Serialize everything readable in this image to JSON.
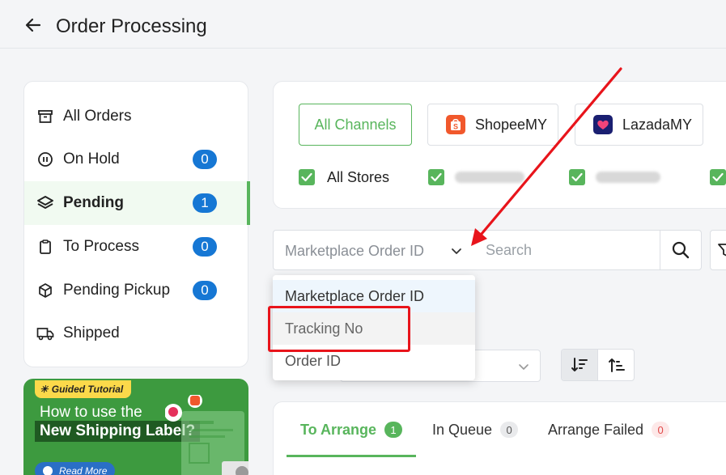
{
  "header": {
    "title": "Order Processing"
  },
  "sidebar": {
    "items": [
      {
        "label": "All Orders",
        "icon": "archive-box-icon",
        "count": null,
        "active": false
      },
      {
        "label": "On Hold",
        "icon": "pause-circle-icon",
        "count": "0",
        "active": false
      },
      {
        "label": "Pending",
        "icon": "layers-icon",
        "count": "1",
        "active": true
      },
      {
        "label": "To Process",
        "icon": "clipboard-icon",
        "count": "0",
        "active": false
      },
      {
        "label": "Pending Pickup",
        "icon": "package-icon",
        "count": "0",
        "active": false
      },
      {
        "label": "Shipped",
        "icon": "truck-icon",
        "count": null,
        "active": false
      }
    ]
  },
  "promo": {
    "pill": "Guided Tutorial",
    "line1": "How to use the",
    "line2": "New Shipping Label?",
    "read_more": "Read More"
  },
  "channels": {
    "buttons": [
      {
        "label": "All Channels",
        "selected": true
      },
      {
        "label": "ShopeeMY",
        "logo": "shopee-logo-icon"
      },
      {
        "label": "LazadaMY",
        "logo": "lazada-logo-icon"
      }
    ],
    "stores": [
      {
        "label": "All Stores",
        "checked": true
      }
    ]
  },
  "search": {
    "field_value": "Marketplace Order ID",
    "placeholder": "Search",
    "field_options": [
      "Marketplace Order ID",
      "Tracking No",
      "Order ID"
    ]
  },
  "tabs": [
    {
      "label": "To Arrange",
      "count": "1"
    },
    {
      "label": "In Queue",
      "count": "0"
    },
    {
      "label": "Arrange Failed",
      "count": "0"
    }
  ],
  "colors": {
    "accent_green": "#58b55c",
    "badge_blue": "#1677d4",
    "annotation_red": "#e8141b",
    "shopee_orange": "#f1582c",
    "lazada_navy": "#1a1f71"
  }
}
